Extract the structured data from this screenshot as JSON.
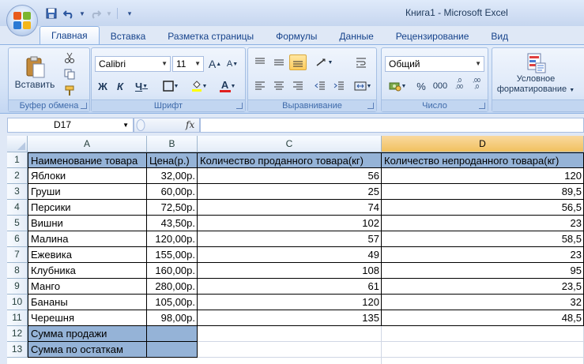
{
  "window": {
    "title_doc": "Книга1",
    "title_sep": " - ",
    "title_app": "Microsoft Excel"
  },
  "tabs": [
    "Главная",
    "Вставка",
    "Разметка страницы",
    "Формулы",
    "Данные",
    "Рецензирование",
    "Вид"
  ],
  "ribbon": {
    "clipboard": {
      "paste_label": "Вставить",
      "group_label": "Буфер обмена"
    },
    "font": {
      "font_name": "Calibri",
      "font_size": "11",
      "bold": "Ж",
      "italic": "К",
      "underline": "Ч",
      "grow": "A",
      "shrink": "A",
      "font_color_glyph": "A",
      "group_label": "Шрифт"
    },
    "alignment": {
      "group_label": "Выравнивание"
    },
    "number": {
      "format": "Общий",
      "percent": "%",
      "thousands": "000",
      "inc_dec": ",0 ,00",
      "dec_dec": ",00 ,0",
      "group_label": "Число"
    },
    "styles": {
      "cond_format_line1": "Условное",
      "cond_format_line2": "форматирование",
      "group_label_partial": "С"
    }
  },
  "formula_bar": {
    "name_box": "D17",
    "fx": "fx",
    "formula": ""
  },
  "sheet": {
    "columns": [
      "A",
      "B",
      "C",
      "D"
    ],
    "selected_column": "D",
    "row_numbers": [
      "1",
      "2",
      "3",
      "4",
      "5",
      "6",
      "7",
      "8",
      "9",
      "10",
      "11",
      "12",
      "13"
    ],
    "header": [
      "Наименование товара",
      "Цена(р.)",
      "Количество проданного товара(кг)",
      "Количество непроданного товара(кг)"
    ],
    "rows": [
      [
        "Яблоки",
        "32,00р.",
        "56",
        "120"
      ],
      [
        "Груши",
        "60,00р.",
        "25",
        "89,5"
      ],
      [
        "Персики",
        "72,50р.",
        "74",
        "56,5"
      ],
      [
        "Вишни",
        "43,50р.",
        "102",
        "23"
      ],
      [
        "Малина",
        "120,00р.",
        "57",
        "58,5"
      ],
      [
        "Ежевика",
        "155,00р.",
        "49",
        "23"
      ],
      [
        "Клубника",
        "160,00р.",
        "108",
        "95"
      ],
      [
        "Манго",
        "280,00р.",
        "61",
        "23,5"
      ],
      [
        "Бананы",
        "105,00р.",
        "120",
        "32"
      ],
      [
        "Черешня",
        "98,00р.",
        "135",
        "48,5"
      ]
    ],
    "summary": [
      "Сумма продажи",
      "Сумма по остаткам"
    ],
    "colors": {
      "header_fill": "#95b3d7",
      "selected_col_header": "#f1c15f"
    }
  }
}
